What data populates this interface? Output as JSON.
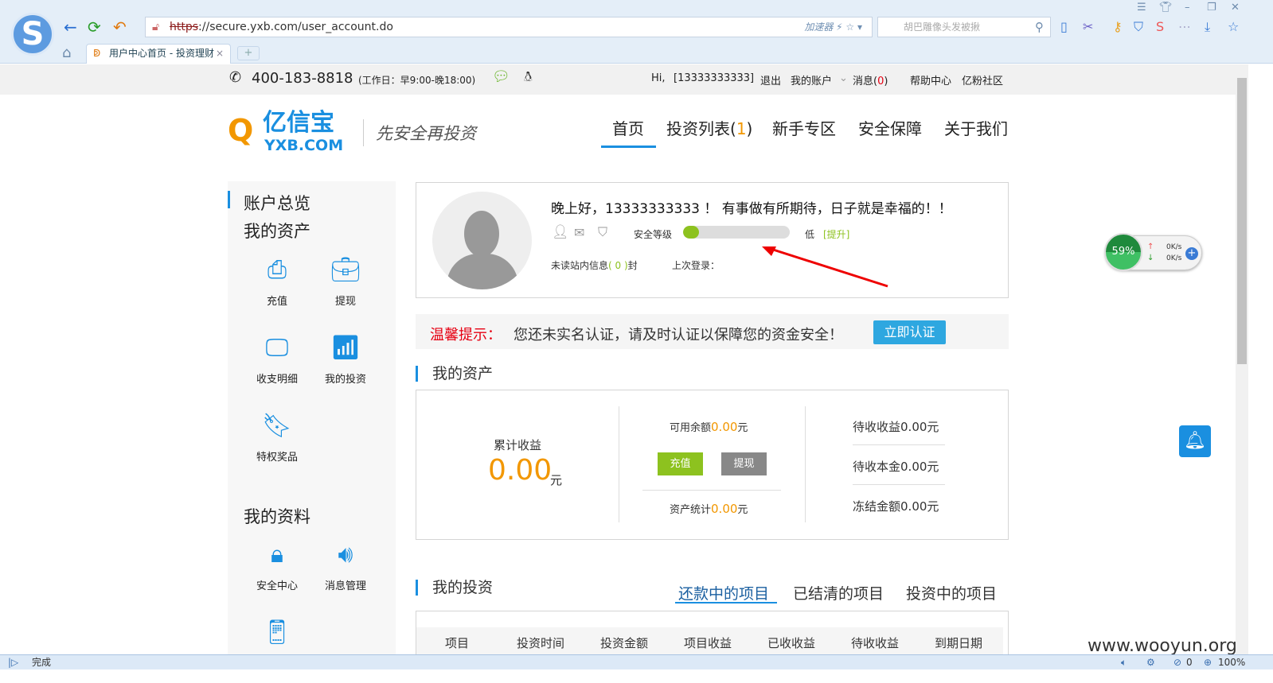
{
  "browser": {
    "url_proto": "https",
    "url_rest": "://secure.yxb.com/user_account.do",
    "accelerator": "加速器",
    "search_placeholder": "胡巴雕像头发被揪",
    "tab_title": "用户中心首页 - 投资理财",
    "new_tab": "+",
    "status_text": "完成",
    "status_count": "0",
    "zoom": "100%"
  },
  "topbar": {
    "phone": "400-183-8818",
    "hours": "(工作日：早9:00-晚18:00)",
    "greeting": "Hi,",
    "user": "[13333333333]",
    "logout": "退出",
    "my_account": "我的账户",
    "messages": "消息(",
    "msg_count": "0",
    "msg_close": ")",
    "help": "帮助中心",
    "community": "亿粉社区"
  },
  "header": {
    "logo_cn": "亿信宝",
    "logo_en": "YXB.COM",
    "slogan": "先安全再投资",
    "nav": [
      {
        "label": "首页"
      },
      {
        "label": "投资列表("
      },
      {
        "label": "新手专区"
      },
      {
        "label": "安全保障"
      },
      {
        "label": "关于我们"
      }
    ],
    "invest_count": "1",
    "invest_close": ")"
  },
  "sidebar": {
    "overview": "账户总览",
    "assets_title": "我的资产",
    "assets": [
      "充值",
      "提现",
      "收支明细",
      "我的投资",
      "特权奖品"
    ],
    "profile_title": "我的资料",
    "profile": [
      "安全中心",
      "消息管理"
    ]
  },
  "welcome": {
    "greeting": "晚上好，13333333333 ！ 有事做有所期待，日子就是幸福的！！",
    "security_label": "安全等级",
    "security_level": "低",
    "security_fraction": 0.15,
    "upgrade": "[提升]",
    "unread_prefix": "未读站内信息",
    "unread_count": "( 0 )",
    "unread_suffix": "封",
    "last_login": "上次登录："
  },
  "notice": {
    "label": "温馨提示：",
    "text": "您还未实名认证，请及时认证以保障您的资金安全！",
    "button": "立即认证"
  },
  "assets": {
    "title": "我的资产",
    "cumulative_label": "累计收益",
    "cumulative_value": "0.00",
    "unit": "元",
    "available_label": "可用余额",
    "available_value": "0.00",
    "recharge": "充值",
    "withdraw": "提现",
    "stats_label": "资产统计",
    "stats_value": "0.00",
    "pending_income": "待收收益",
    "pending_income_value": "0.00元",
    "pending_principal": "待收本金",
    "pending_principal_value": "0.00元",
    "frozen": "冻结金额",
    "frozen_value": "0.00元"
  },
  "investments": {
    "title": "我的投资",
    "tabs": [
      "还款中的项目",
      "已结清的项目",
      "投资中的项目"
    ],
    "columns": [
      "项目",
      "投资时间",
      "投资金额",
      "项目收益",
      "已收收益",
      "待收收益",
      "到期日期"
    ]
  },
  "widget": {
    "percent": "59%",
    "up": "0K/s",
    "down": "0K/s"
  },
  "watermark": "www.wooyun.org",
  "colors": {
    "accent": "#1a8fe0",
    "orange": "#f29700",
    "green": "#8dc21f",
    "red": "#e60012"
  }
}
